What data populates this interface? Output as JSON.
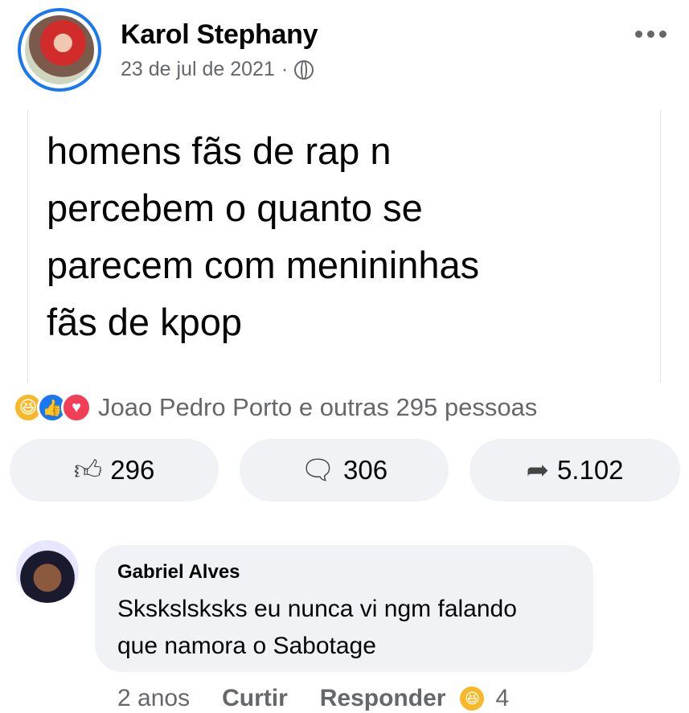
{
  "post": {
    "author": "Karol Stephany",
    "date": "23 de jul de 2021",
    "separator": "·",
    "privacy_icon": "globe-icon",
    "text": "homens fãs de rap n\npercebem o quanto se\nparecem com menininhas\nfãs de kpop"
  },
  "reactions": {
    "icons": [
      "haha-icon",
      "like-icon",
      "love-icon"
    ],
    "summary": "Joao Pedro Porto e outras 295 pessoas"
  },
  "actions": {
    "likes": "296",
    "comments": "306",
    "shares": "5.102"
  },
  "comment": {
    "author": "Gabriel Alves",
    "text": "Skskslsksks eu nunca vi ngm falando\nque namora o Sabotage",
    "time": "2 anos",
    "like_label": "Curtir",
    "reply_label": "Responder",
    "reaction_count": "4"
  },
  "colors": {
    "accent": "#1877f2",
    "secondary_text": "#65676b",
    "pill_bg": "#f0f2f5",
    "haha": "#f7b928",
    "love": "#f33e58"
  }
}
